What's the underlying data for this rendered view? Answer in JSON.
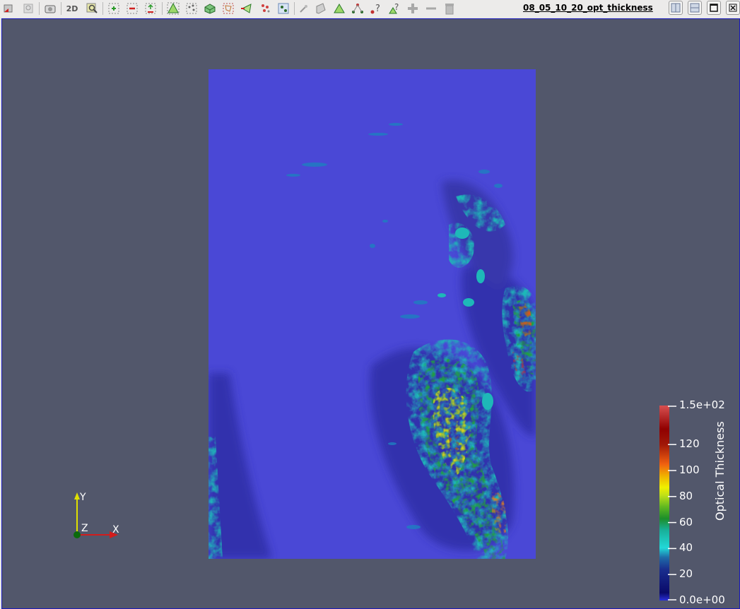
{
  "toolbar": {
    "buttons": [
      {
        "name": "reset-camera-closest-icon"
      },
      {
        "name": "zoom-closest-icon"
      },
      {
        "name": "screenshot-icon"
      },
      {
        "name": "toggle-2d-button",
        "label": "2D"
      },
      {
        "name": "zoom-to-box-icon"
      },
      {
        "name": "select-points-on-icon"
      },
      {
        "name": "select-points-off-icon"
      },
      {
        "name": "grow-selection-icon"
      },
      {
        "name": "select-cells-on-icon"
      },
      {
        "name": "select-points-frustum-icon"
      },
      {
        "name": "select-block-icon"
      },
      {
        "name": "select-cells-polygon-icon"
      },
      {
        "name": "interactive-select-cells-icon"
      },
      {
        "name": "interactive-select-points-icon"
      },
      {
        "name": "hover-points-icon"
      },
      {
        "name": "hover-cells-icon"
      },
      {
        "name": "select-cells-with-polygon-icon"
      },
      {
        "name": "probe-points-icon"
      },
      {
        "name": "cells-query-icon"
      },
      {
        "name": "points-query-icon"
      },
      {
        "name": "grow-selection-plus-icon"
      },
      {
        "name": "shrink-selection-minus-icon"
      },
      {
        "name": "clear-selection-trash-icon"
      }
    ],
    "view_title": "08_05_10_20_opt_thickness",
    "window_buttons": [
      {
        "name": "split-horizontal-icon"
      },
      {
        "name": "split-vertical-icon"
      },
      {
        "name": "maximize-icon"
      },
      {
        "name": "close-view-icon"
      }
    ]
  },
  "viewport": {
    "background": "#52576b",
    "field_background": "#4a48d6"
  },
  "colorbar": {
    "title": "Optical Thickness",
    "range": [
      0,
      150
    ],
    "labels": [
      {
        "text": "1.5e+02",
        "value": 150
      },
      {
        "text": "120",
        "value": 120
      },
      {
        "text": "100",
        "value": 100
      },
      {
        "text": "80",
        "value": 80
      },
      {
        "text": "60",
        "value": 60
      },
      {
        "text": "40",
        "value": 40
      },
      {
        "text": "20",
        "value": 20
      },
      {
        "text": "0.0e+00",
        "value": 0
      }
    ],
    "colors": [
      "#0a0a6a",
      "#1e3c9c",
      "#1eb4c8",
      "#28e0d0",
      "#20b040",
      "#80d020",
      "#f0f000",
      "#f0a000",
      "#e04000",
      "#a00000",
      "#d03030"
    ]
  },
  "orientation_axes": {
    "x_label": "X",
    "y_label": "Y",
    "z_label": "Z",
    "x_color": "#d21c1c",
    "y_color": "#e0e000",
    "z_color": "#0a6a0a"
  }
}
